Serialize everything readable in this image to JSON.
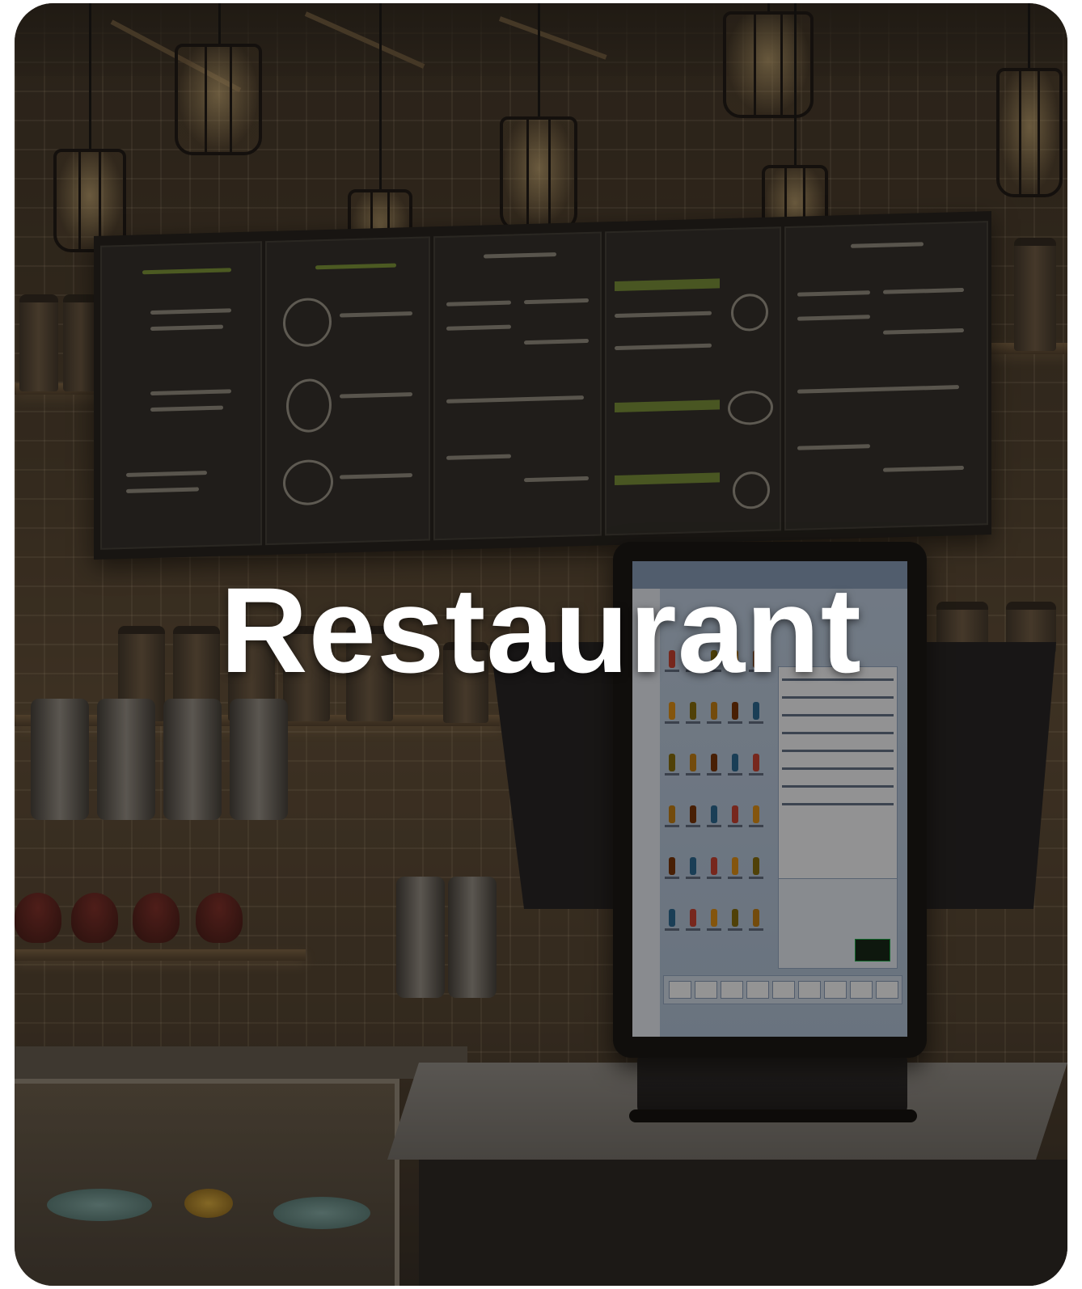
{
  "card": {
    "title": "Restaurant"
  },
  "scene": {
    "subject": "pos-terminal",
    "background": "restaurant-counter",
    "pendant_lamps": 7,
    "menu_panels": 5
  },
  "colors": {
    "title": "#ffffff",
    "overlay": "#120e0a",
    "screen": "#b6c8dd"
  }
}
